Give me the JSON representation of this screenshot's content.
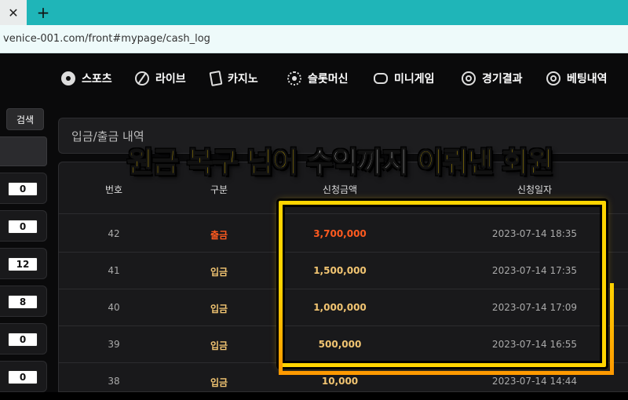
{
  "browser": {
    "tab_close": "✕",
    "new_tab": "+",
    "url": "venice-001.com/front#mypage/cash_log"
  },
  "nav": {
    "items": [
      {
        "label": "스포츠",
        "icon": "soccer-ball-icon"
      },
      {
        "label": "라이브",
        "icon": "basketball-icon"
      },
      {
        "label": "카지노",
        "icon": "playing-card-icon"
      },
      {
        "label": "슬롯머신",
        "icon": "ship-wheel-icon"
      },
      {
        "label": "미니게임",
        "icon": "gamepad-icon"
      },
      {
        "label": "경기결과",
        "icon": "target-icon"
      },
      {
        "label": "베팅내역",
        "icon": "target-icon"
      }
    ]
  },
  "sidebar": {
    "search_label": "검색",
    "counts": [
      "0",
      "0",
      "12",
      "8",
      "0",
      "0"
    ]
  },
  "section": {
    "title": "입금/출금 내역"
  },
  "table": {
    "headers": [
      "번호",
      "구분",
      "신청금액",
      "신청일자"
    ],
    "rows": [
      {
        "num": "42",
        "type": "출금",
        "amount": "3,700,000",
        "date": "2023-07-14 18:35"
      },
      {
        "num": "41",
        "type": "입금",
        "amount": "1,500,000",
        "date": "2023-07-14 17:35"
      },
      {
        "num": "40",
        "type": "입금",
        "amount": "1,000,000",
        "date": "2023-07-14 17:09"
      },
      {
        "num": "39",
        "type": "입금",
        "amount": "500,000",
        "date": "2023-07-14 16:55"
      },
      {
        "num": "38",
        "type": "입금",
        "amount": "10,000",
        "date": "2023-07-14 14:44"
      }
    ]
  },
  "caption": {
    "parts": [
      "원금",
      "복구",
      "넘어",
      "수익까지",
      "이뤄낸",
      "회원"
    ]
  },
  "colors": {
    "withdraw": "#ff5a1f",
    "deposit": "#f2c572",
    "amount_withdraw": "#ff5a1f",
    "amount_deposit": "#f2c572",
    "highlight": "#ffd400"
  }
}
